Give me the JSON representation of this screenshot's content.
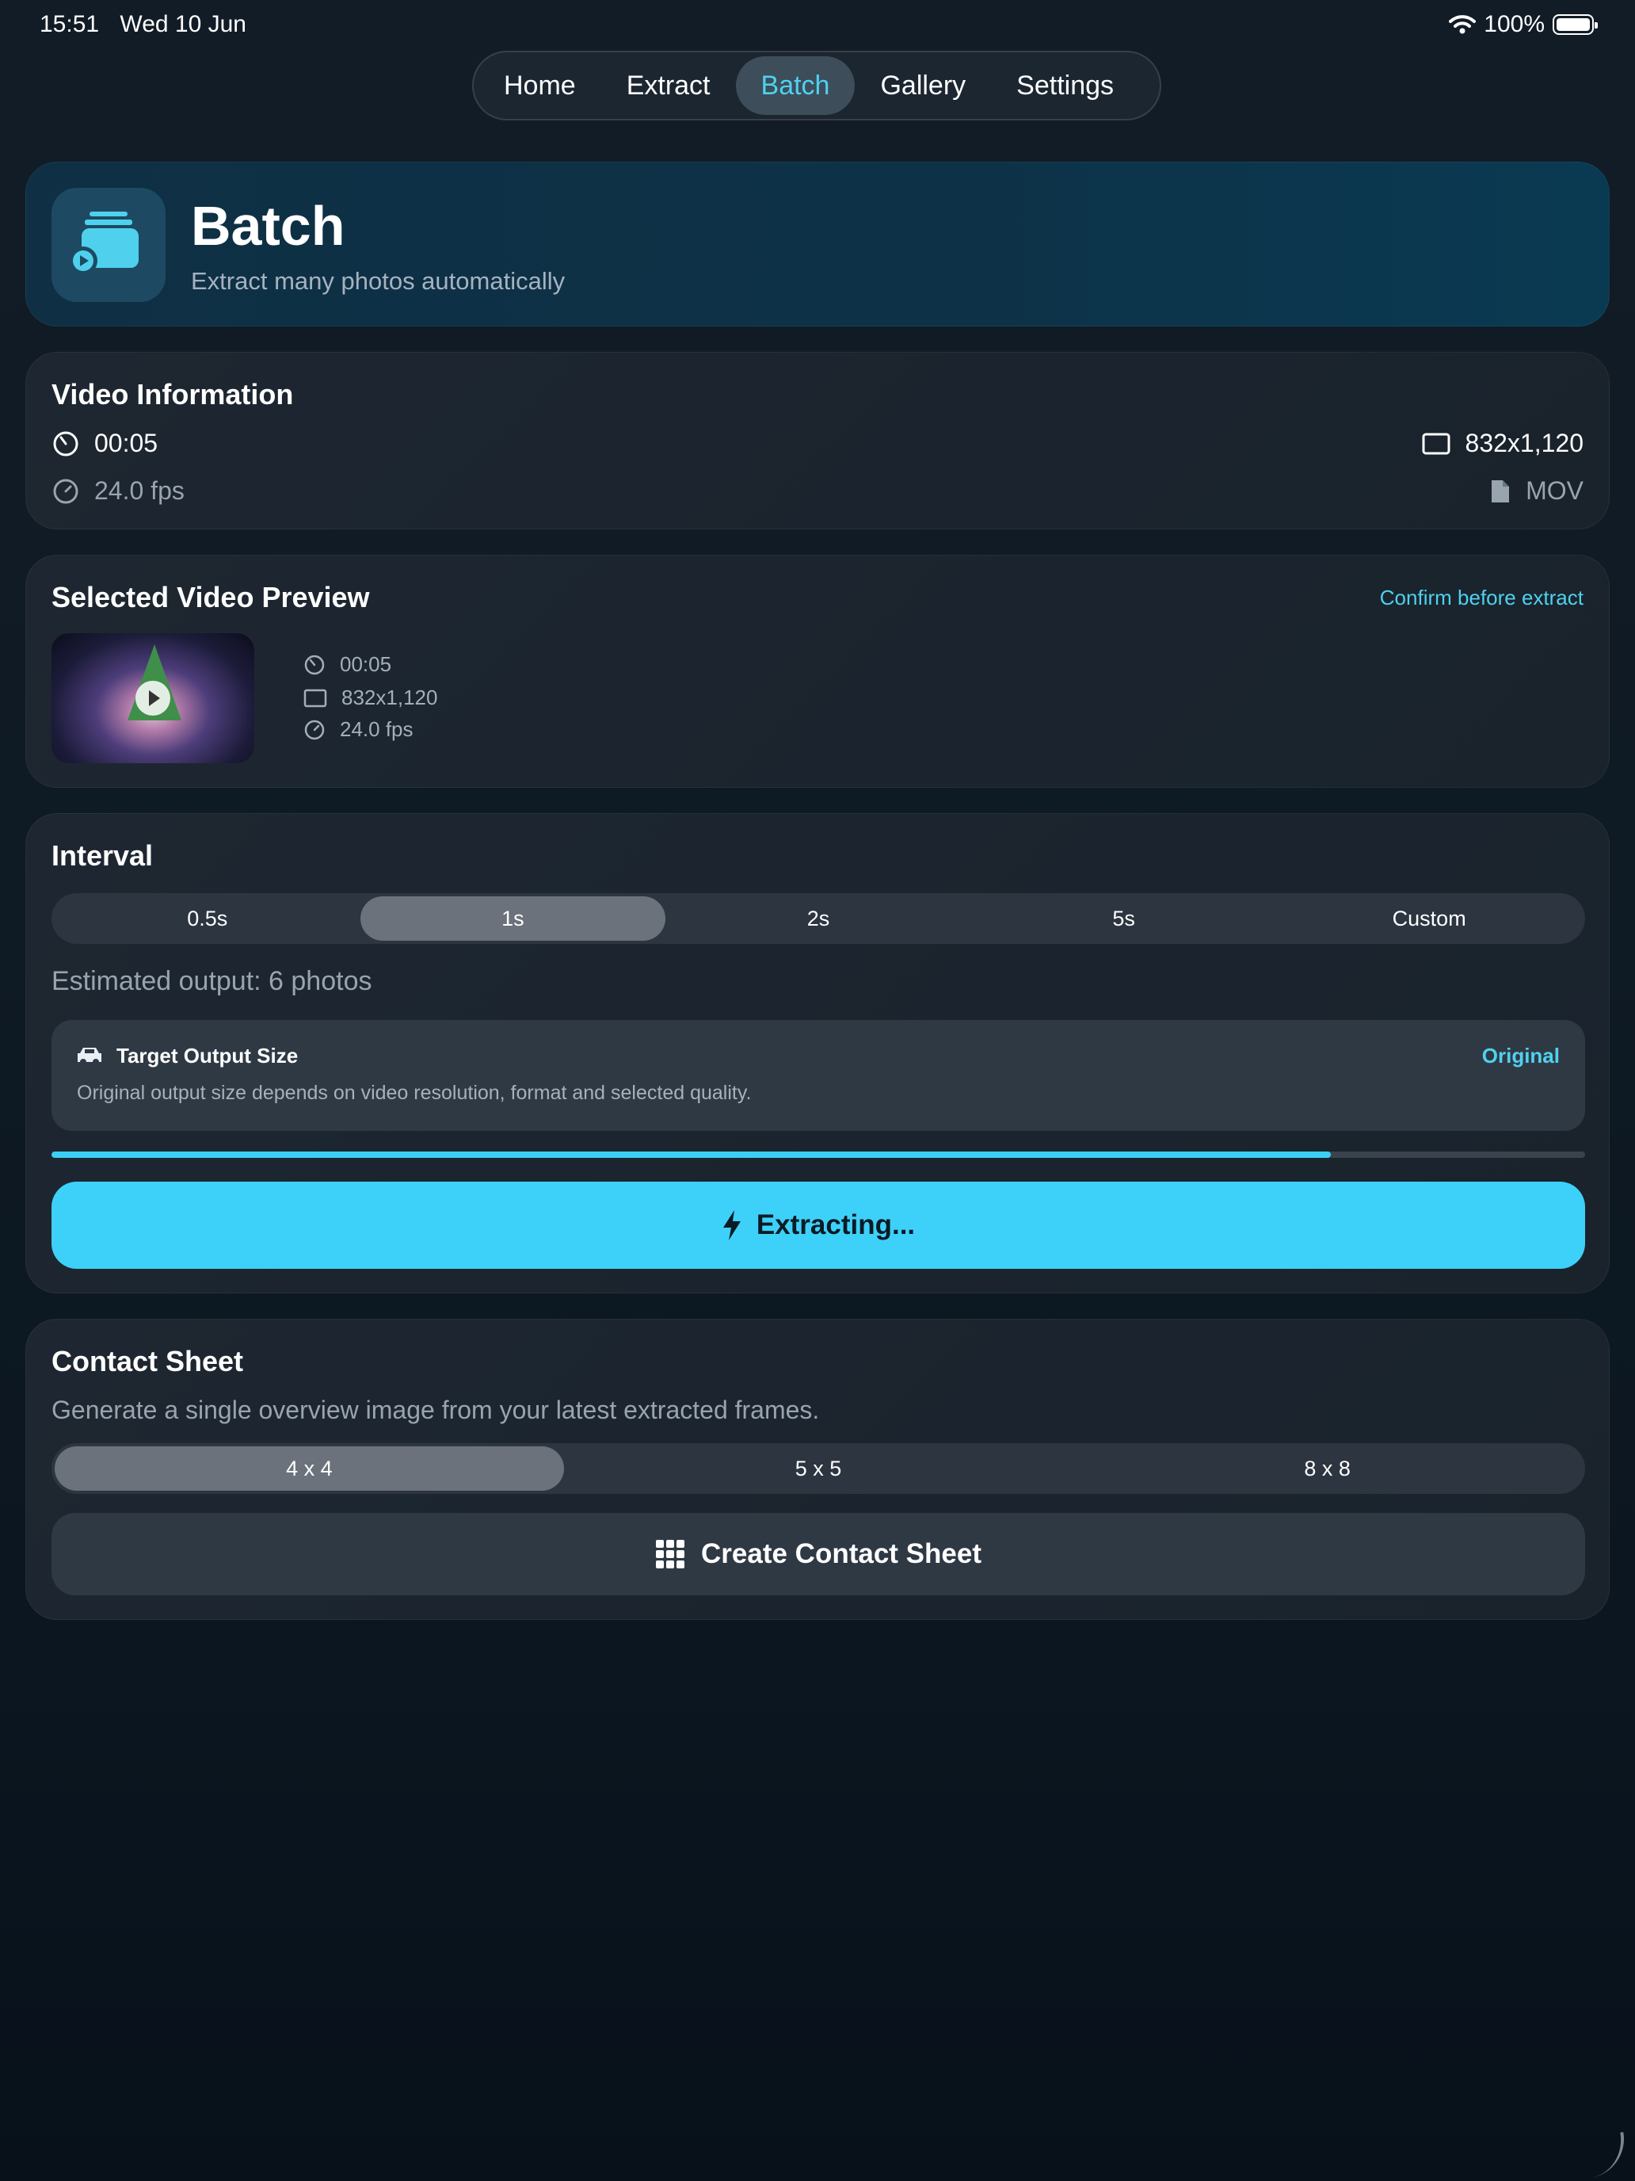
{
  "status": {
    "time": "15:51",
    "date": "Wed 10 Jun",
    "battery": "100%"
  },
  "nav": {
    "items": [
      {
        "label": "Home"
      },
      {
        "label": "Extract"
      },
      {
        "label": "Batch"
      },
      {
        "label": "Gallery"
      },
      {
        "label": "Settings"
      }
    ],
    "active": "Batch"
  },
  "hero": {
    "title": "Batch",
    "subtitle": "Extract many photos automatically",
    "icon": "stack-photos-icon"
  },
  "video_info": {
    "title": "Video Information",
    "duration": "00:05",
    "resolution": "832x1,120",
    "fps": "24.0 fps",
    "format": "MOV"
  },
  "preview": {
    "title": "Selected Video Preview",
    "confirm_label": "Confirm before extract",
    "duration": "00:05",
    "resolution": "832x1,120",
    "fps": "24.0 fps"
  },
  "interval": {
    "title": "Interval",
    "options": [
      {
        "label": "0.5s"
      },
      {
        "label": "1s"
      },
      {
        "label": "2s"
      },
      {
        "label": "5s"
      },
      {
        "label": "Custom"
      }
    ],
    "selected": "1s",
    "estimate": "Estimated output: 6 photos",
    "target": {
      "title": "Target Output Size",
      "value": "Original",
      "description": "Original output size depends on video resolution, format and selected quality."
    },
    "progress": 0.834,
    "button_label": "Extracting..."
  },
  "contact_sheet": {
    "title": "Contact Sheet",
    "description": "Generate a single overview image from your latest extracted frames.",
    "options": [
      {
        "label": "4 x 4"
      },
      {
        "label": "5 x 5"
      },
      {
        "label": "8 x 8"
      }
    ],
    "selected": "4 x 4",
    "button_label": "Create Contact Sheet"
  },
  "colors": {
    "accent": "#4fd1ee",
    "button": "#3dd1fa",
    "card": "#1e2731"
  }
}
